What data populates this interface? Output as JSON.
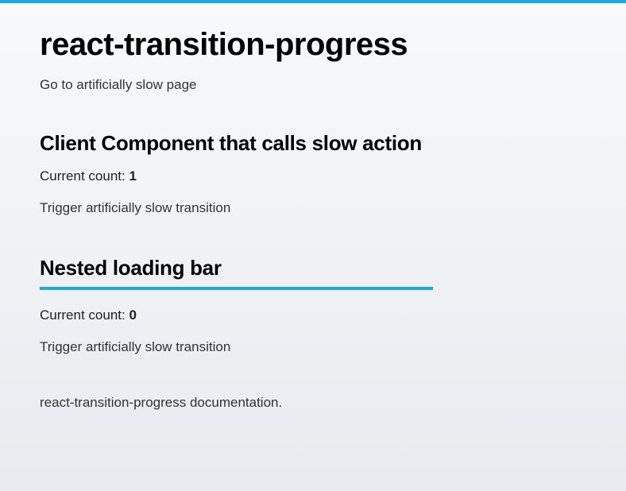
{
  "page": {
    "title": "react-transition-progress",
    "slow_page_link": "Go to artificially slow page",
    "documentation_link": "react-transition-progress documentation."
  },
  "client_component": {
    "heading": "Client Component that calls slow action",
    "count_label": "Current count: ",
    "count_value": "1",
    "trigger_text": "Trigger artificially slow transition"
  },
  "nested": {
    "heading": "Nested loading bar",
    "count_label": "Current count: ",
    "count_value": "0",
    "trigger_text": "Trigger artificially slow transition"
  },
  "colors": {
    "progress_bar": "#1ba9e1"
  }
}
